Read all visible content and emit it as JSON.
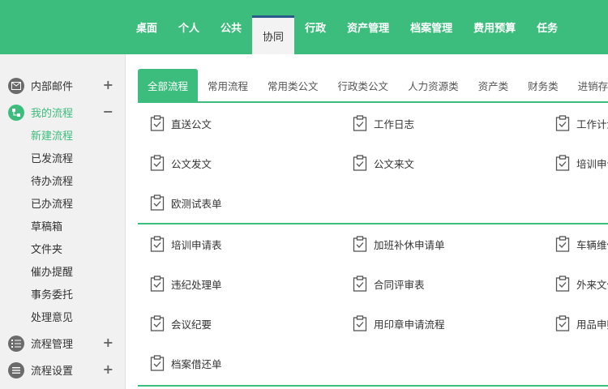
{
  "top_nav": [
    {
      "label": "桌面"
    },
    {
      "label": "个人"
    },
    {
      "label": "公共"
    },
    {
      "label": "协同",
      "active": true
    },
    {
      "label": "行政"
    },
    {
      "label": "资产管理"
    },
    {
      "label": "档案管理"
    },
    {
      "label": "费用预算"
    },
    {
      "label": "任务"
    }
  ],
  "sidebar": {
    "groups": [
      {
        "label": "内部邮件",
        "toggle": "+",
        "icon": "mail-icon"
      },
      {
        "label": "我的流程",
        "toggle": "−",
        "icon": "flow-icon",
        "open": true,
        "items": [
          "新建流程",
          "已发流程",
          "待办流程",
          "已办流程",
          "草稿箱",
          "文件夹",
          "催办提醒",
          "事务委托",
          "处理意见"
        ]
      },
      {
        "label": "流程管理",
        "toggle": "+",
        "icon": "list-icon"
      },
      {
        "label": "流程设置",
        "toggle": "+",
        "icon": "menu-icon"
      }
    ]
  },
  "tabs": [
    "全部流程",
    "常用流程",
    "常用类公文",
    "行政类公文",
    "人力资源类",
    "资产类",
    "财务类",
    "进销存类"
  ],
  "sections": [
    {
      "items": [
        "直送公文",
        "工作日志",
        "工作计划",
        "公文发文",
        "公文来文",
        "培训申请",
        "欧测试表单"
      ]
    },
    {
      "items": [
        "培训申请表",
        "加班补休申请单",
        "车辆维修",
        "违纪处理单",
        "合同评审表",
        "外来文件",
        "会议纪要",
        "用印章申请流程",
        "用品申购",
        "档案借还单"
      ]
    }
  ],
  "colors": {
    "accent": "#3dbd7d",
    "sidebar_bg": "#f1f1f1"
  }
}
